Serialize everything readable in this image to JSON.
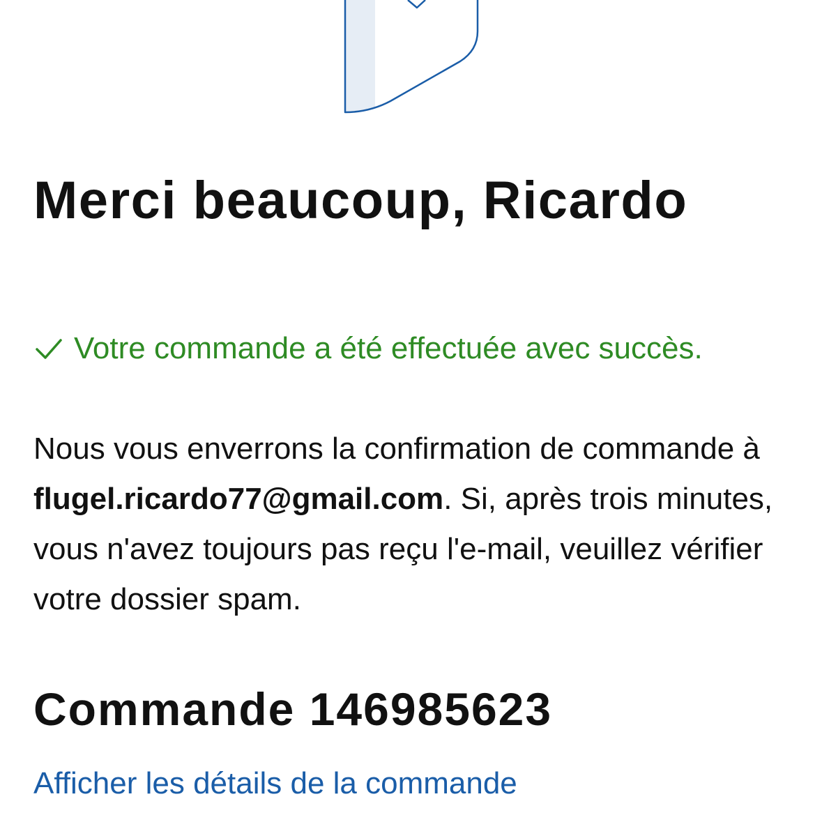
{
  "illustration": {
    "icon": "order-confirmation-shield-icon"
  },
  "header": {
    "title": "Merci beaucoup, Ricardo"
  },
  "status": {
    "icon": "checkmark-icon",
    "text": "Votre commande a été effectuée avec succès.",
    "color": "#2e8b24"
  },
  "message": {
    "part1": "Nous vous enverrons la confirmation de commande à ",
    "email": "flugel.ricardo77@gmail.com",
    "part2": ". Si, après trois minutes, vous n'avez toujours pas reçu l'e-mail, veuillez vérifier votre dossier spam."
  },
  "order": {
    "title": "Commande 146985623",
    "details_link": "Afficher les détails de la commande",
    "link_color": "#1a5da8"
  }
}
